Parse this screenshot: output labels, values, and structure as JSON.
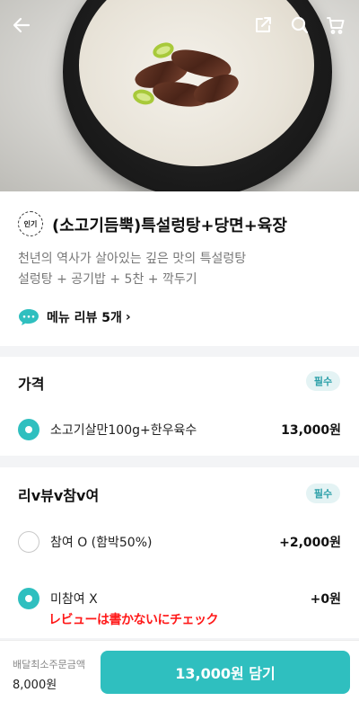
{
  "header": {
    "back_icon": "back-arrow-icon",
    "share_icon": "share-icon",
    "search_icon": "search-icon",
    "cart_icon": "cart-icon"
  },
  "product": {
    "badge": "인기",
    "title": "(소고기듬뿍)특설렁탕+당면+육장",
    "description_line1": "천년의 역사가 살아있는 깊은 맛의 특설렁탕",
    "description_line2": "설렁탕 + 공기밥 + 5찬 + 깍두기",
    "review_link": "메뉴 리뷰 5개",
    "review_arrow": "›"
  },
  "price_section": {
    "title": "가격",
    "required": "필수",
    "options": [
      {
        "label": "소고기살만100g+한우육수",
        "price": "13,000원",
        "selected": true
      }
    ]
  },
  "review_section": {
    "title": "리v뷰v참v여",
    "required": "필수",
    "options": [
      {
        "label": "참여 O (함박50%)",
        "price": "+2,000원",
        "selected": false
      },
      {
        "label": "미참여 X",
        "price": "+0원",
        "selected": true
      }
    ],
    "annotation": "レビューは書かないにチェック"
  },
  "footer": {
    "min_order_label": "배달최소주문금액",
    "min_order_value": "8,000원",
    "order_button": "13,000원 담기"
  },
  "colors": {
    "accent": "#2fbfbf",
    "annotation": "#ff1a1a",
    "required_bg": "#e4f3f4",
    "required_text": "#2a9fa8"
  }
}
